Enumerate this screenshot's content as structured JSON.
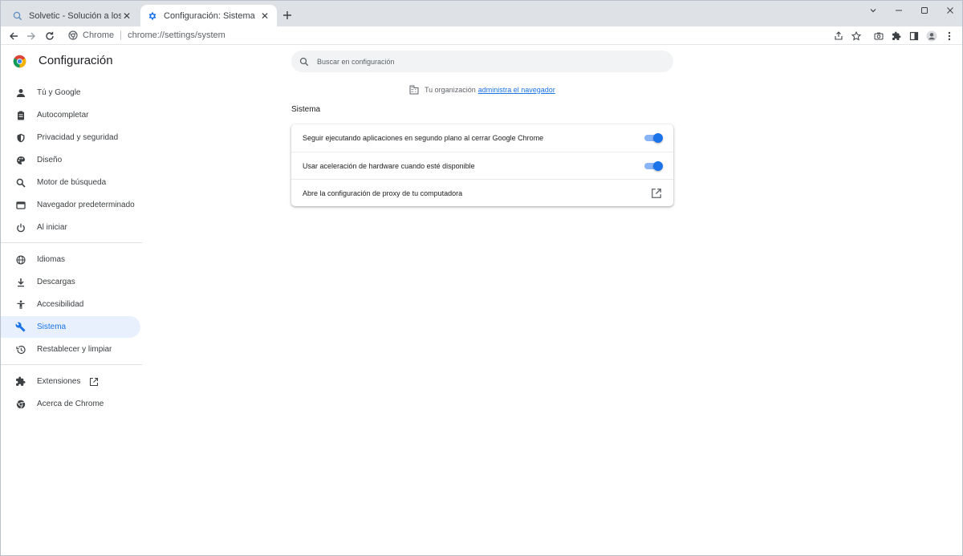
{
  "tabs": [
    {
      "title": "Solvetic - Solución a los problem",
      "favicon": "search-globe-icon",
      "active": false
    },
    {
      "title": "Configuración: Sistema",
      "favicon": "gear-icon",
      "active": true
    }
  ],
  "toolbar": {
    "site_chip": "Chrome",
    "url_scheme": "chrome://",
    "url_path": "settings/system"
  },
  "header": {
    "title": "Configuración"
  },
  "search": {
    "placeholder": "Buscar en configuración"
  },
  "sidebar": {
    "items": [
      {
        "label": "Tú y Google",
        "icon": "person-icon"
      },
      {
        "label": "Autocompletar",
        "icon": "clipboard-icon"
      },
      {
        "label": "Privacidad y seguridad",
        "icon": "shield-icon"
      },
      {
        "label": "Diseño",
        "icon": "palette-icon"
      },
      {
        "label": "Motor de búsqueda",
        "icon": "search-icon"
      },
      {
        "label": "Navegador predeterminado",
        "icon": "browser-window-icon"
      },
      {
        "label": "Al iniciar",
        "icon": "power-icon"
      },
      {
        "label": "Idiomas",
        "icon": "globe-icon"
      },
      {
        "label": "Descargas",
        "icon": "download-icon"
      },
      {
        "label": "Accesibilidad",
        "icon": "accessibility-icon"
      },
      {
        "label": "Sistema",
        "icon": "wrench-icon",
        "selected": true
      },
      {
        "label": "Restablecer y limpiar",
        "icon": "history-icon"
      },
      {
        "label": "Extensiones",
        "icon": "puzzle-icon"
      },
      {
        "label": "Acerca de Chrome",
        "icon": "chrome-icon"
      }
    ]
  },
  "managed_notice": {
    "prefix": "Tu organización",
    "link": "administra el navegador"
  },
  "section": {
    "title": "Sistema",
    "rows": [
      {
        "label": "Seguir ejecutando aplicaciones en segundo plano al cerrar Google Chrome",
        "control": "toggle",
        "enabled": true
      },
      {
        "label": "Usar aceleración de hardware cuando esté disponible",
        "control": "toggle",
        "enabled": true
      },
      {
        "label": "Abre la configuración de proxy de tu computadora",
        "control": "external-link"
      }
    ]
  },
  "colors": {
    "accent": "#1a73e8",
    "selected_bg": "#e8f0fe",
    "tabstrip_bg": "#dee1e6",
    "toggle_track": "#8ab4f8"
  }
}
